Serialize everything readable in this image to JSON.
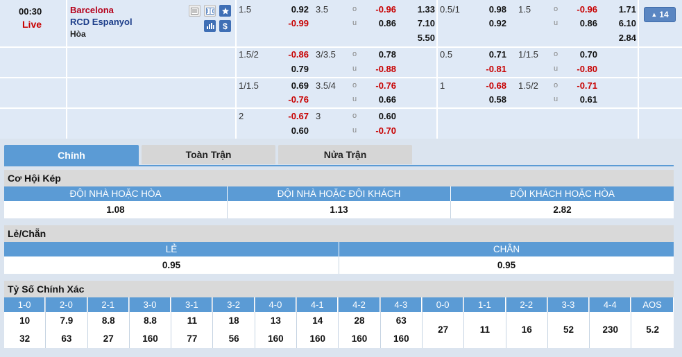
{
  "match": {
    "time": "00:30",
    "status": "Live",
    "home_team": "Barcelona",
    "away_team": "RCD Espanyol",
    "draw_label": "Hòa",
    "more_count": "14",
    "more_arrow": "▲"
  },
  "odds_rows": [
    {
      "h_line": "1.5",
      "h_home": "0.92",
      "h_away": "-0.99",
      "ou_line": "3.5",
      "o_val": "-0.96",
      "u_val": "0.86",
      "x12_home": "1.33",
      "x12_away": "7.10",
      "x12_draw": "5.50",
      "fh_line": "0.5/1",
      "fh_home": "0.98",
      "fh_away": "0.92",
      "fou_line": "1.5",
      "fo_val": "-0.96",
      "fu_val": "0.86",
      "fx12_home": "1.71",
      "fx12_away": "6.10",
      "fx12_draw": "2.84"
    },
    {
      "h_line": "1.5/2",
      "h_home": "-0.86",
      "h_away": "0.79",
      "ou_line": "3/3.5",
      "o_val": "0.78",
      "u_val": "-0.88",
      "fh_line": "0.5",
      "fh_home": "0.71",
      "fh_away": "-0.81",
      "fou_line": "1/1.5",
      "fo_val": "0.70",
      "fu_val": "-0.80"
    },
    {
      "h_line": "1/1.5",
      "h_home": "0.69",
      "h_away": "-0.76",
      "ou_line": "3.5/4",
      "o_val": "-0.76",
      "u_val": "0.66",
      "fh_line": "1",
      "fh_home": "-0.68",
      "fh_away": "0.58",
      "fou_line": "1.5/2",
      "fo_val": "-0.71",
      "fu_val": "0.61"
    },
    {
      "h_line": "2",
      "h_home": "-0.67",
      "h_away": "0.60",
      "ou_line": "3",
      "o_val": "0.60",
      "u_val": "-0.70"
    }
  ],
  "ou_labels": {
    "over": "o",
    "under": "u"
  },
  "tabs": [
    "Chính",
    "Toàn Trận",
    "Nửa Trận"
  ],
  "double_chance": {
    "title": "Cơ Hội Kép",
    "headers": [
      "ĐỘI NHÀ HOẶC HÒA",
      "ĐỘI NHÀ HOẶC ĐỘI KHÁCH",
      "ĐỘI KHÁCH HOẶC HÒA"
    ],
    "values": [
      "1.08",
      "1.13",
      "2.82"
    ]
  },
  "odd_even": {
    "title": "Lẻ/Chẵn",
    "headers": [
      "LẺ",
      "CHẴN"
    ],
    "values": [
      "0.95",
      "0.95"
    ]
  },
  "correct_score": {
    "title": "Tỷ Số Chính Xác",
    "home_scores": [
      "1-0",
      "2-0",
      "2-1",
      "3-0",
      "3-1",
      "3-2",
      "4-0",
      "4-1",
      "4-2",
      "4-3"
    ],
    "home_odds": [
      "10",
      "7.9",
      "8.8",
      "8.8",
      "11",
      "18",
      "13",
      "14",
      "28",
      "63"
    ],
    "away_odds": [
      "32",
      "63",
      "27",
      "160",
      "77",
      "56",
      "160",
      "160",
      "160",
      "160"
    ],
    "draw_scores": [
      "0-0",
      "1-1",
      "2-2",
      "3-3",
      "4-4",
      "AOS"
    ],
    "draw_odds": [
      "27",
      "11",
      "16",
      "52",
      "230",
      "5.2"
    ]
  },
  "colors": {
    "accent": "#5b9bd5",
    "row_bg": "#dfe9f6",
    "negative": "#c80000",
    "home_team": "#b5001a",
    "away_team": "#1d3e8a"
  }
}
